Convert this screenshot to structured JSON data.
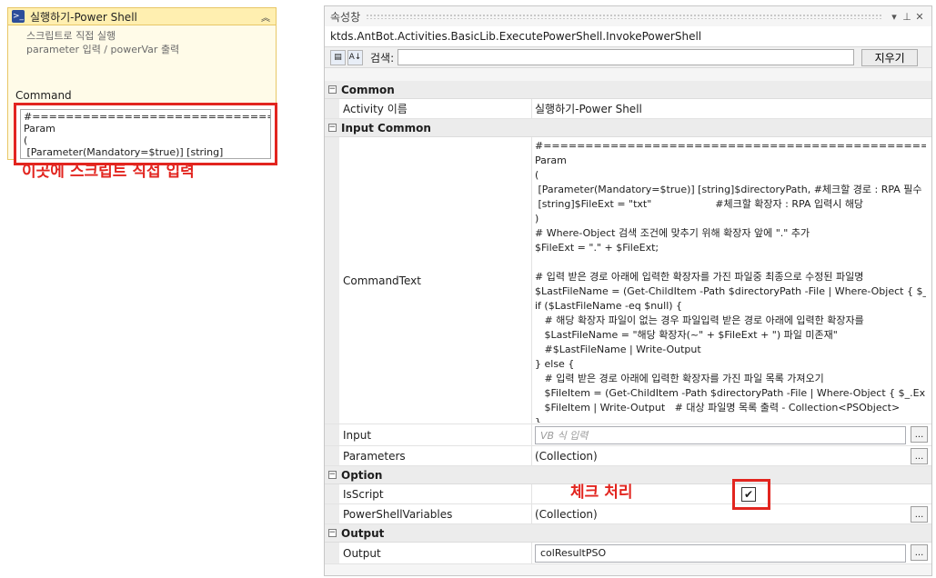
{
  "activity": {
    "title": "실행하기-Power Shell",
    "desc_line1": "스크립트로 직접 실행",
    "desc_line2": "parameter 입력 / powerVar 출력",
    "command_label": "Command",
    "command_preview": "#====================================\nParam\n(\n [Parameter(Mandatory=$true)] [string]\n$directoryPath, #체크할 경로 : RPA 필수 입력",
    "annotation": "이곳에 스크립트 직접 입력"
  },
  "panel": {
    "title": "속성창",
    "type_name": "ktds.AntBot.Activities.BasicLib.ExecutePowerShell.InvokePowerShell",
    "search_label": "검색:",
    "search_value": "",
    "clear_label": "지우기"
  },
  "categories": {
    "common": "Common",
    "input_common": "Input Common",
    "option": "Option",
    "output": "Output"
  },
  "props": {
    "activity_name_label": "Activity 이름",
    "activity_name_value": "실행하기-Power Shell",
    "command_text_label": "CommandText",
    "command_text_value": "#===================================================\nParam\n(\n [Parameter(Mandatory=$true)] [string]$directoryPath, #체크할 경로 : RPA 필수\n [string]$FileExt = \"txt\"                    #체크할 확장자 : RPA 입력시 해당\n)\n# Where-Object 검색 조건에 맞추기 위해 확장자 앞에 \".\" 추가\n$FileExt = \".\" + $FileExt;\n\n# 입력 받은 경로 아래에 입력한 확장자를 가진 파일중 최종으로 수정된 파일명\n$LastFileName = (Get-ChildItem -Path $directoryPath -File | Where-Object { $_\nif ($LastFileName -eq $null) {\n   # 해당 확장자 파일이 없는 경우 파일입력 받은 경로 아래에 입력한 확장자를\n   $LastFileName = \"해당 확장자(~\" + $FileExt + \") 파일 미존재\"\n   #$LastFileName | Write-Output\n} else {\n   # 입력 받은 경로 아래에 입력한 확장자를 가진 파일 목록 가져오기\n   $FileItem = (Get-ChildItem -Path $directoryPath -File | Where-Object { $_.Ex\n   $FileItem | Write-Output   # 대상 파일명 목록 출력 - Collection<PSObject>\n}",
    "input_label": "Input",
    "input_placeholder": "VB 식 입력",
    "parameters_label": "Parameters",
    "parameters_value": "(Collection)",
    "isscript_label": "IsScript",
    "isscript_checked": true,
    "check_mark": "✔",
    "isscript_annotation": "체크 처리",
    "psvars_label": "PowerShellVariables",
    "psvars_value": "(Collection)",
    "output_label": "Output",
    "output_value": "colResultPSO",
    "ellipsis": "..."
  }
}
